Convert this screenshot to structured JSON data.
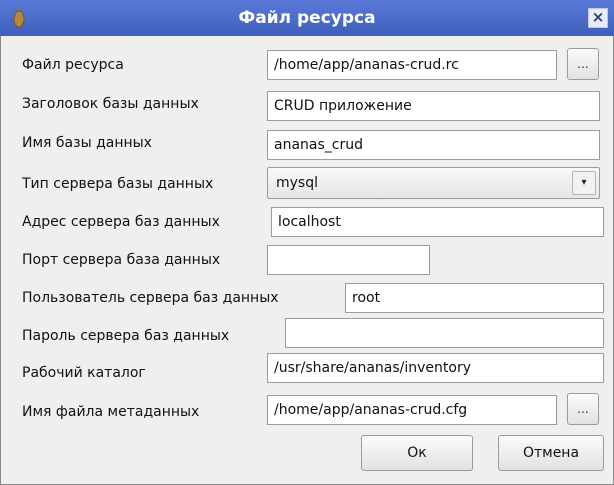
{
  "window": {
    "title": "Файл ресурса",
    "close_glyph": "×",
    "icon": "pineapple-app-icon"
  },
  "form": {
    "resource_file": {
      "label": "Файл ресурса",
      "value": "/home/app/ananas-crud.rc"
    },
    "db_title": {
      "label": "Заголовок базы данных",
      "value": "CRUD приложение"
    },
    "db_name": {
      "label": "Имя базы данных",
      "value": "ananas_crud"
    },
    "db_server_type": {
      "label": "Тип сервера базы данных",
      "value": "mysql"
    },
    "db_server_address": {
      "label": "Адрес сервера баз данных",
      "value": "localhost"
    },
    "db_server_port": {
      "label": "Порт сервера база данных",
      "value": ""
    },
    "db_server_user": {
      "label": "Пользователь сервера баз данных",
      "value": "root"
    },
    "db_server_password": {
      "label": "Пароль сервера баз данных",
      "value": ""
    },
    "work_dir": {
      "label": "Рабочий каталог",
      "value": "/usr/share/ananas/inventory"
    },
    "metadata_file": {
      "label": "Имя файла метаданных",
      "value": "/home/app/ananas-crud.cfg"
    }
  },
  "browse_label": "...",
  "combo_arrow_glyph": "▾",
  "buttons": {
    "ok": "Ок",
    "cancel": "Отмена"
  }
}
